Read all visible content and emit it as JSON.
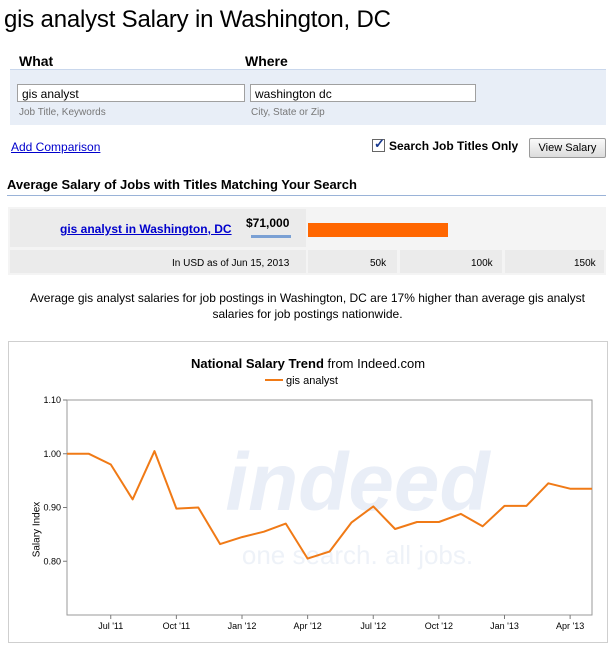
{
  "page": {
    "title": "gis analyst Salary in Washington, DC"
  },
  "search": {
    "what_label": "What",
    "where_label": "Where",
    "what_value": "gis analyst",
    "where_value": "washington dc",
    "what_hint": "Job Title, Keywords",
    "where_hint": "City, State or Zip",
    "add_comparison": "Add Comparison",
    "search_titles_only_label": "Search Job Titles Only",
    "search_titles_only_checked": true,
    "view_salary_label": "View Salary"
  },
  "results": {
    "heading": "Average Salary of Jobs with Titles Matching Your Search",
    "job_link": "gis analyst in Washington, DC",
    "salary": "$71,000",
    "salary_value": 71000,
    "scale_max": 150000,
    "currency_note": "In USD as of Jun 15, 2013",
    "ticks": [
      "50k",
      "100k",
      "150k"
    ],
    "bar_color": "#ff6600"
  },
  "note": {
    "text": "Average gis analyst salaries for job postings in Washington, DC are 17% higher than average gis analyst salaries for job postings nationwide."
  },
  "chart_data": {
    "type": "line",
    "title_bold": "National Salary Trend",
    "title_rest": " from Indeed.com",
    "ylabel": "Salary Index",
    "ylim": [
      0.7,
      1.1
    ],
    "yticks": [
      "0.80",
      "0.90",
      "1.00",
      "1.10"
    ],
    "xticks": [
      "Jul '11",
      "Oct '11",
      "Jan '12",
      "Apr '12",
      "Jul '12",
      "Oct '12",
      "Jan '13",
      "Apr '13"
    ],
    "watermark_logo": "indeed",
    "watermark_tagline": "one search. all jobs.",
    "grid": false,
    "legend": "top-center",
    "series": [
      {
        "name": "gis analyst",
        "color": "#f07a16",
        "x": [
          "2011-05",
          "2011-06",
          "2011-07",
          "2011-08",
          "2011-09",
          "2011-10",
          "2011-11",
          "2011-12",
          "2012-01",
          "2012-02",
          "2012-03",
          "2012-04",
          "2012-05",
          "2012-06",
          "2012-07",
          "2012-08",
          "2012-09",
          "2012-10",
          "2012-11",
          "2012-12",
          "2013-01",
          "2013-02",
          "2013-03",
          "2013-04",
          "2013-05"
        ],
        "values": [
          1.0,
          1.0,
          0.98,
          0.915,
          1.005,
          0.898,
          0.9,
          0.832,
          0.845,
          0.855,
          0.87,
          0.805,
          0.818,
          0.872,
          0.902,
          0.86,
          0.873,
          0.873,
          0.888,
          0.865,
          0.903,
          0.903,
          0.945,
          0.935,
          0.935
        ]
      }
    ]
  }
}
